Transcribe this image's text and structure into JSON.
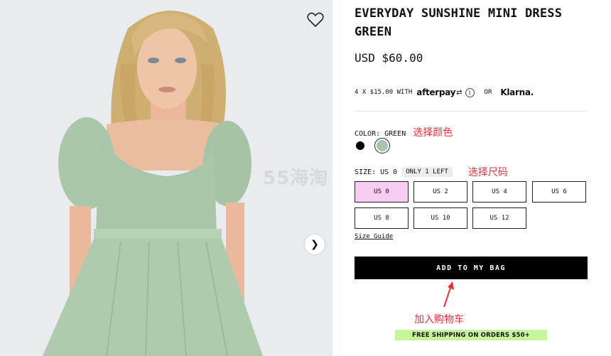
{
  "product": {
    "title": "EVERYDAY SUNSHINE MINI DRESS GREEN",
    "price": "USD $60.00"
  },
  "payments": {
    "installments": "4 X $15.00 WITH",
    "afterpay": "afterpay",
    "or": "OR",
    "klarna": "Klarna."
  },
  "color": {
    "label": "COLOR:",
    "value": "GREEN",
    "annotation": "选择颜色",
    "swatches": [
      {
        "name": "black",
        "color": "#000000"
      },
      {
        "name": "green",
        "color": "#a9c4ad",
        "selected": true
      }
    ]
  },
  "size": {
    "label": "SIZE:",
    "value": "US 0",
    "stock_badge": "ONLY 1 LEFT",
    "annotation": "选择尺码",
    "options": [
      "US 0",
      "US 2",
      "US 4",
      "US 6",
      "US 8",
      "US 10",
      "US 12"
    ],
    "selected": "US 0",
    "guide": "Size Guide"
  },
  "cart": {
    "button": "ADD TO MY BAG",
    "annotation": "加入购物车"
  },
  "promo": {
    "shipping": "FREE SHIPPING ON ORDERS $50+"
  },
  "gallery": {
    "next_glyph": "❯"
  },
  "watermark": "55海淘",
  "colors": {
    "accent_selected": "#f7cdf4",
    "annotation_red": "#e8323c",
    "promo_green": "#c7f59c"
  }
}
